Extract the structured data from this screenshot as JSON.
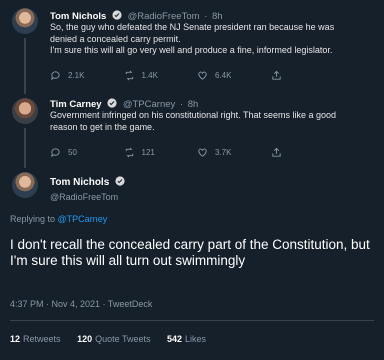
{
  "tweets": [
    {
      "name": "Tom Nichols",
      "handle": "@RadioFreeTom",
      "time": "8h",
      "text_lines": [
        "So, the guy who defeated the NJ Senate president ran because he was",
        "denied a concealed carry permit.",
        "I'm sure this will all go very well and produce a fine, informed legislator."
      ],
      "replies": "2.1K",
      "retweets": "1.4K",
      "likes": "6.4K"
    },
    {
      "name": "Tim Carney",
      "handle": "@TPCarney",
      "time": "8h",
      "text_lines": [
        "Government infringed on his constitutional right. That seems like a good",
        "reason to get in the game."
      ],
      "replies": "50",
      "retweets": "121",
      "likes": "3.7K"
    }
  ],
  "main_tweet": {
    "name": "Tom Nichols",
    "handle": "@RadioFreeTom",
    "replying_prefix": "Replying to",
    "replying_to": "@TPCarney",
    "text": "I don't recall the concealed carry part of the Constitution, but I'm sure this will all turn out swimmingly",
    "meta": "4:37 PM · Nov 4, 2021 · TweetDeck",
    "retweets_count": "12",
    "retweets_label": "Retweets",
    "quote_count": "120",
    "quote_label": "Quote Tweets",
    "likes_count": "542",
    "likes_label": "Likes"
  },
  "colors": {
    "background": "#15202b",
    "link": "#1d9bf0",
    "muted": "#8b98a5"
  }
}
